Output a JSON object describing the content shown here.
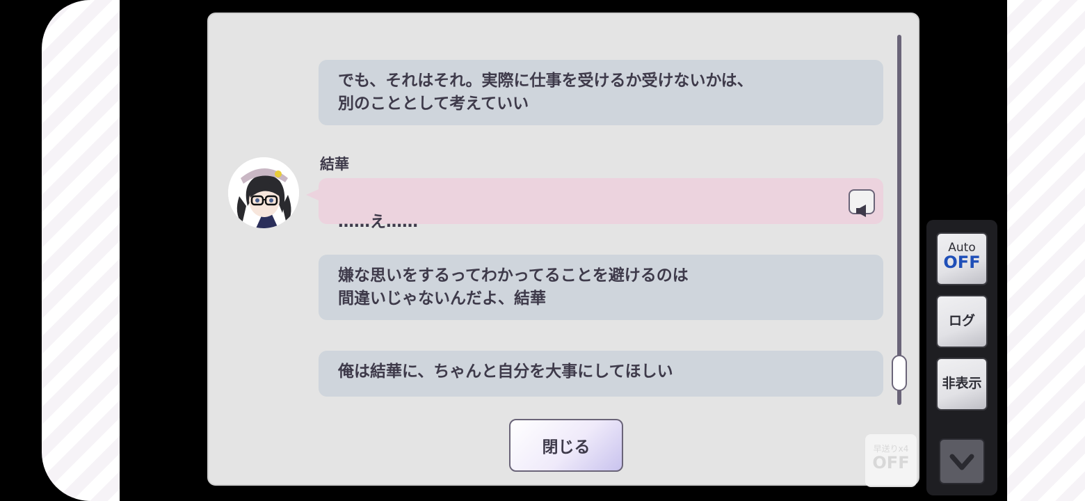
{
  "log": {
    "messages": [
      {
        "text": "でも、それはそれ。実際に仕事を受けるか受けないかは、\n別のこととして考えていい"
      },
      {
        "speaker": "結華",
        "text": "……え……"
      },
      {
        "text": "嫌な思いをするってわかってることを避けるのは\n間違いじゃないんだよ、結華"
      },
      {
        "text": "俺は結華に、ちゃんと自分を大事にしてほしい"
      }
    ],
    "close_label": "閉じる"
  },
  "controls": {
    "auto_label": "Auto",
    "auto_state": "OFF",
    "log_label": "ログ",
    "hide_label": "非表示",
    "fast_forward_label": "早送りx4",
    "fast_forward_state": "OFF"
  },
  "colors": {
    "narration_bubble": "#cfd5dc",
    "character_bubble": "#ecd3de",
    "panel": "#e4e4e4",
    "auto_state": "#1f4fb8"
  },
  "icons": [
    "speaker-icon",
    "chevron-down-icon",
    "character-avatar"
  ]
}
